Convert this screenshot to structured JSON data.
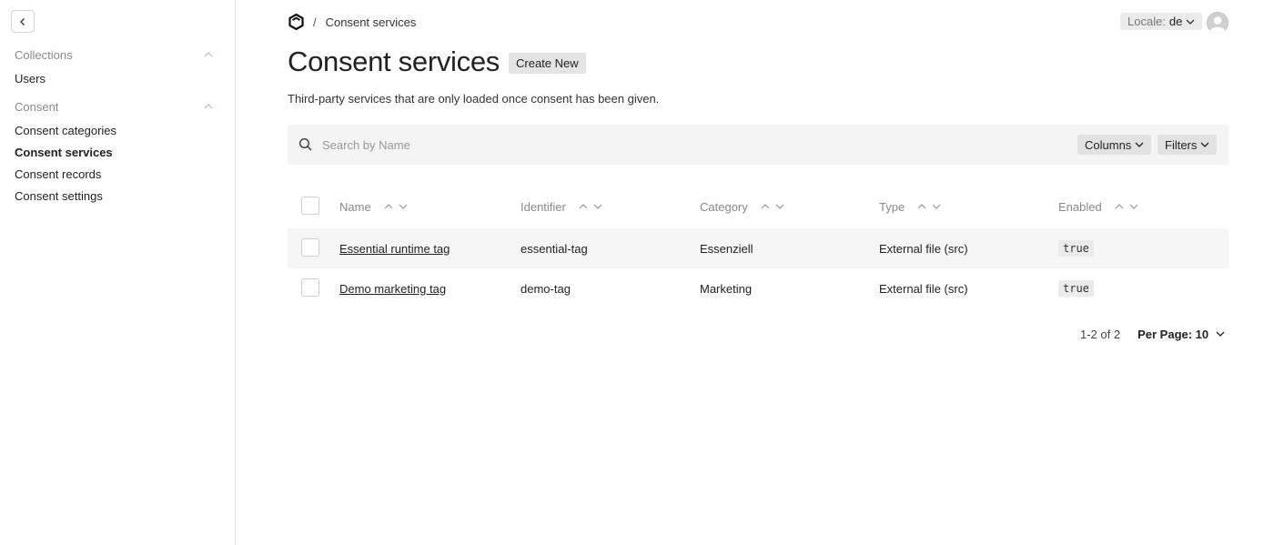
{
  "sidebar": {
    "groups": [
      {
        "label": "Collections",
        "items": [
          {
            "label": "Users"
          }
        ]
      },
      {
        "label": "Consent",
        "items": [
          {
            "label": "Consent categories"
          },
          {
            "label": "Consent services"
          },
          {
            "label": "Consent records"
          },
          {
            "label": "Consent settings"
          }
        ]
      }
    ]
  },
  "header": {
    "breadcrumb_sep": "/",
    "breadcrumb": "Consent services",
    "locale_label": "Locale:",
    "locale_value": "de"
  },
  "page": {
    "title": "Consent services",
    "create_label": "Create New",
    "description": "Third-party services that are only loaded once consent has been given."
  },
  "search": {
    "placeholder": "Search by Name",
    "columns_label": "Columns",
    "filters_label": "Filters"
  },
  "table": {
    "columns": [
      "Name",
      "Identifier",
      "Category",
      "Type",
      "Enabled"
    ],
    "rows": [
      {
        "name": "Essential runtime tag",
        "identifier": "essential-tag",
        "category": "Essenziell",
        "type": "External file (src)",
        "enabled": "true"
      },
      {
        "name": "Demo marketing tag",
        "identifier": "demo-tag",
        "category": "Marketing",
        "type": "External file (src)",
        "enabled": "true"
      }
    ]
  },
  "pagination": {
    "info": "1-2 of 2",
    "per_page": "Per Page: 10"
  }
}
